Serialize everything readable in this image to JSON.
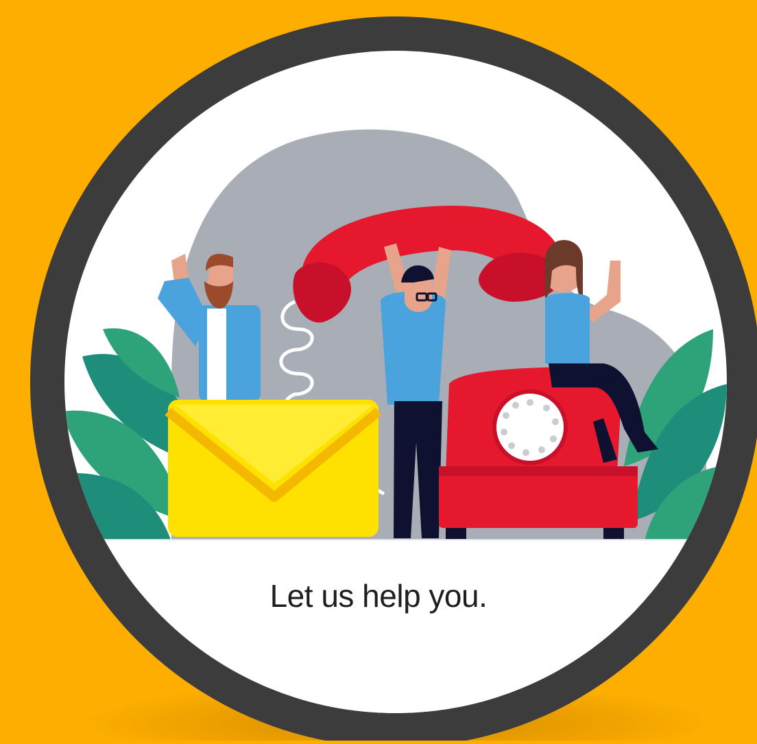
{
  "caption": "Let us help you.",
  "colors": {
    "background": "#FDAE00",
    "ring": "#3C3C3C",
    "inner": "#FFFFFF",
    "blob": "#A9ADB5",
    "handset": "#E5182E",
    "envelope": "#FFE100",
    "leaf_dark": "#1E8E7B",
    "leaf_light": "#2EA37A",
    "shirt": "#4BA3DE",
    "pants": "#0E1130"
  },
  "icons": [
    "envelope-icon",
    "telephone-icon",
    "handset-icon",
    "rotary-dial-icon",
    "leaf-icon"
  ]
}
